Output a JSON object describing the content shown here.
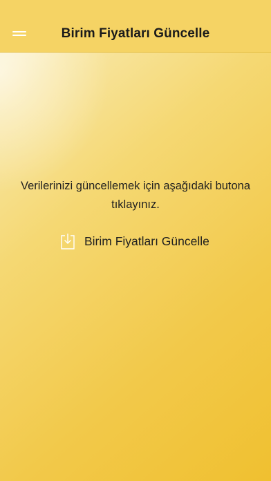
{
  "header": {
    "title": "Birim Fiyatları Güncelle",
    "menu_icon": "hamburger-menu-icon"
  },
  "main": {
    "message": "Verilerinizi güncellemek için aşağıdaki butona tıklayınız.",
    "update_button": {
      "label": "Birim Fiyatları Güncelle",
      "icon": "download-icon"
    }
  },
  "colors": {
    "background_top": "#fdf6df",
    "background_bottom": "#f0c030",
    "navbar": "#f5d364",
    "icon": "#ffffff",
    "text": "#1f1f1f"
  }
}
